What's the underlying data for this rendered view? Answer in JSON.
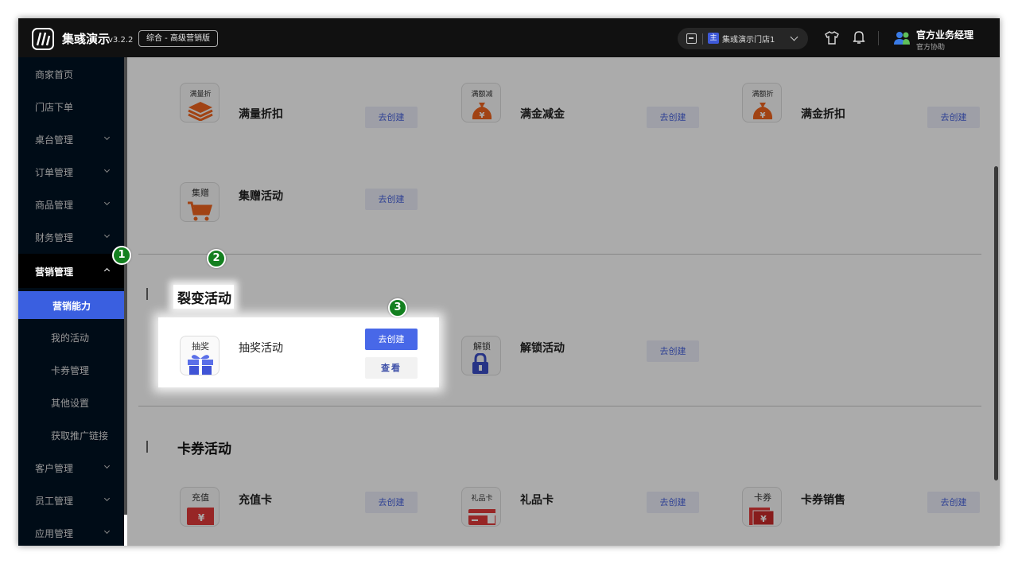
{
  "header": {
    "brand": "集彧演示",
    "version": "v3.2.2",
    "edition": "综合 - 高级营销版",
    "store_badge": "主",
    "store_name": "集彧演示门店1",
    "user_name": "官方业务经理",
    "user_role": "官方协助"
  },
  "sidebar": {
    "items": [
      {
        "label": "商家首页"
      },
      {
        "label": "门店下单"
      },
      {
        "label": "桌台管理"
      },
      {
        "label": "订单管理"
      },
      {
        "label": "商品管理"
      },
      {
        "label": "财务管理"
      },
      {
        "label": "营销管理"
      },
      {
        "label": "营销能力"
      },
      {
        "label": "我的活动"
      },
      {
        "label": "卡券管理"
      },
      {
        "label": "其他设置"
      },
      {
        "label": "获取推广链接"
      },
      {
        "label": "客户管理"
      },
      {
        "label": "员工管理"
      },
      {
        "label": "应用管理"
      }
    ]
  },
  "main": {
    "create_label": "去创建",
    "view_label": "查看",
    "promo": {
      "cards": [
        {
          "tile": "满量折",
          "name": "满量折扣",
          "icon": "stack-icon"
        },
        {
          "tile": "满额减",
          "name": "满金减金",
          "icon": "money-bag-icon"
        },
        {
          "tile": "满额折",
          "name": "满金折扣",
          "icon": "money-bag-icon"
        },
        {
          "tile": "集赠",
          "name": "集赠活动",
          "icon": "cart-icon"
        }
      ]
    },
    "fission": {
      "title": "裂变活动",
      "cards": [
        {
          "tile": "抽奖",
          "name": "抽奖活动",
          "icon": "gift-icon"
        },
        {
          "tile": "解锁",
          "name": "解锁活动",
          "icon": "lock-icon"
        }
      ]
    },
    "coupon": {
      "title": "卡券活动",
      "cards": [
        {
          "tile": "充值",
          "name": "充值卡",
          "icon": "wallet-icon"
        },
        {
          "tile": "礼品卡",
          "name": "礼品卡",
          "icon": "gift-card-icon"
        },
        {
          "tile": "卡券",
          "name": "卡券销售",
          "icon": "coupon-icon"
        }
      ]
    }
  },
  "steps": [
    "1",
    "2",
    "3"
  ],
  "colors": {
    "accent": "#4868e8",
    "sidebar": "#000c17",
    "topbar": "#111111",
    "step": "#13801f",
    "icon_orange": "#f0641e"
  }
}
